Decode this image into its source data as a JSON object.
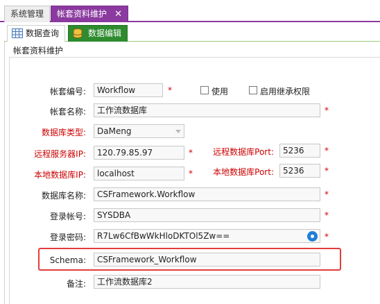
{
  "top_tabs": [
    {
      "label": "系统管理"
    },
    {
      "label": "帐套资料维护"
    }
  ],
  "sub_tabs": [
    {
      "label": "数据查询"
    },
    {
      "label": "数据编辑"
    }
  ],
  "group": {
    "title": "帐套资料维护"
  },
  "form": {
    "account_code": {
      "label": "帐套编号:",
      "value": "Workflow"
    },
    "use": {
      "label": "使用",
      "checked": false
    },
    "inherit": {
      "label": "启用继承权限",
      "checked": false
    },
    "account_name": {
      "label": "帐套名称:",
      "value": "工作流数据库"
    },
    "db_type": {
      "label": "数据库类型:",
      "value": "DaMeng"
    },
    "remote_ip": {
      "label": "远程服务器IP:",
      "value": "120.79.85.97"
    },
    "remote_port": {
      "label": "远程数据库Port:",
      "value": "5236"
    },
    "local_ip": {
      "label": "本地数据库IP:",
      "value": "localhost"
    },
    "local_port": {
      "label": "本地数据库Port:",
      "value": "5236"
    },
    "db_name": {
      "label": "数据库名称:",
      "value": "CSFramework.Workflow"
    },
    "login_account": {
      "label": "登录帐号:",
      "value": "SYSDBA"
    },
    "login_password": {
      "label": "登录密码:",
      "value": "R7Lw6CfBwWkHloDKTOl5Zw=="
    },
    "schema": {
      "label": "Schema:",
      "value": "CSFramework_Workflow"
    },
    "remark": {
      "label": "备注:",
      "value": "工作流数据库2"
    },
    "required_mark": "*"
  },
  "colors": {
    "top_active_tab": "#8b3aa0",
    "sub_active_tab": "#2e8b2e",
    "required_label": "#cc0000",
    "highlight_box": "#e43b3b"
  }
}
